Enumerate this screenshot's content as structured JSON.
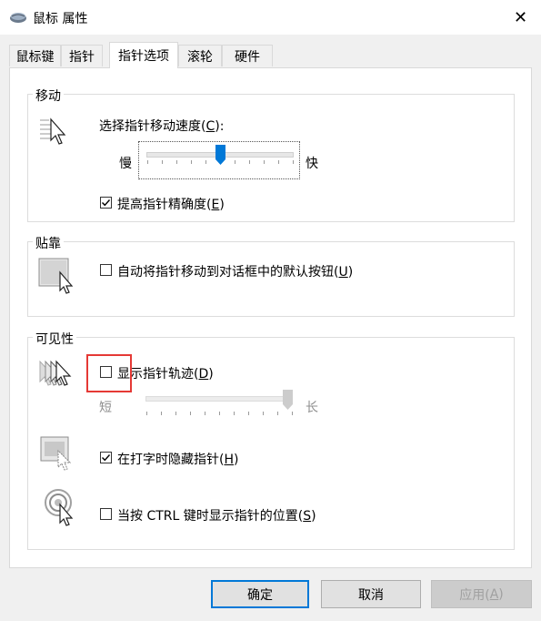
{
  "window": {
    "title": "鼠标 属性",
    "close_glyph": "✕"
  },
  "tabs": [
    {
      "label": "鼠标键",
      "active": false
    },
    {
      "label": "指针",
      "active": false
    },
    {
      "label": "指针选项",
      "active": true
    },
    {
      "label": "滚轮",
      "active": false
    },
    {
      "label": "硬件",
      "active": false
    }
  ],
  "motion": {
    "group_label": "移动",
    "speed_label": "选择指针移动速度(",
    "speed_key": "C",
    "speed_suffix": "):",
    "slow": "慢",
    "fast": "快",
    "speed_level": 0.5,
    "precision_label": "提高指针精确度(",
    "precision_key": "E",
    "precision_suffix": ")",
    "precision_checked": true
  },
  "snap": {
    "group_label": "贴靠",
    "snap_label": "自动将指针移动到对话框中的默认按钮(",
    "snap_key": "U",
    "snap_suffix": ")",
    "snap_checked": false
  },
  "visibility": {
    "group_label": "可见性",
    "trails_label": "显示指针轨迹(",
    "trails_key": "D",
    "trails_suffix": ")",
    "trails_checked": false,
    "short": "短",
    "long": "长",
    "trails_level": 1.0,
    "hide_label": "在打字时隐藏指针(",
    "hide_key": "H",
    "hide_suffix": ")",
    "hide_checked": true,
    "ctrl_label": "当按 CTRL 键时显示指针的位置(",
    "ctrl_key": "S",
    "ctrl_suffix": ")",
    "ctrl_checked": false
  },
  "buttons": {
    "ok": "确定",
    "cancel": "取消",
    "apply_label": "应用(",
    "apply_key": "A",
    "apply_suffix": ")"
  },
  "colors": {
    "accent": "#0078d7",
    "highlight": "#e53935"
  }
}
